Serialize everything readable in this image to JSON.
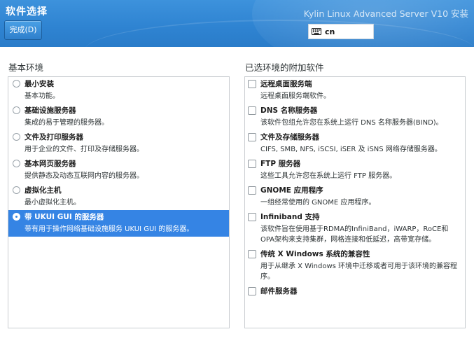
{
  "header": {
    "title": "软件选择",
    "done_label": "完成(D)",
    "product": "Kylin Linux Advanced Server V10 安装",
    "keyboard_layout": "cn",
    "keyboard_icon": "keyboard-icon"
  },
  "base_env": {
    "label": "基本环境",
    "items": [
      {
        "name": "最小安装",
        "desc": "基本功能。",
        "selected": false
      },
      {
        "name": "基础设施服务器",
        "desc": "集成的易于管理的服务器。",
        "selected": false
      },
      {
        "name": "文件及打印服务器",
        "desc": "用于企业的文件、打印及存储服务器。",
        "selected": false
      },
      {
        "name": "基本网页服务器",
        "desc": "提供静态及动态互联网内容的服务器。",
        "selected": false
      },
      {
        "name": "虚拟化主机",
        "desc": "最小虚拟化主机。",
        "selected": false
      },
      {
        "name": "带 UKUI GUI 的服务器",
        "desc": "带有用于操作网络基础设施服务 UKUI GUI 的服务器。",
        "selected": true
      }
    ]
  },
  "addons": {
    "label": "已选环境的附加软件",
    "items": [
      {
        "name": "远程桌面服务端",
        "desc": "远程桌面服务端软件。",
        "checked": false
      },
      {
        "name": "DNS 名称服务器",
        "desc": "该软件包组允许您在系统上运行 DNS 名称服务器(BIND)。",
        "checked": false
      },
      {
        "name": "文件及存储服务器",
        "desc": "CIFS, SMB, NFS, iSCSI, iSER 及 iSNS 网络存储服务器。",
        "checked": false
      },
      {
        "name": "FTP 服务器",
        "desc": "这些工具允许您在系统上运行 FTP 服务器。",
        "checked": false
      },
      {
        "name": "GNOME 应用程序",
        "desc": "一组经常使用的 GNOME 应用程序。",
        "checked": false
      },
      {
        "name": "Infiniband 支持",
        "desc": "该软件旨在使用基于RDMA的InfiniBand，iWARP，RoCE和OPA架构来支持集群，网格连接和低延迟，高带宽存储。",
        "checked": false
      },
      {
        "name": "传统 X Windows 系统的兼容性",
        "desc": "用于从继承 X Windows 环境中迁移或者可用于该环境的兼容程序。",
        "checked": false
      },
      {
        "name": "邮件服务器",
        "desc": "",
        "checked": false
      }
    ]
  },
  "colors": {
    "header": "#2f84d2",
    "selection": "#3584e4"
  }
}
